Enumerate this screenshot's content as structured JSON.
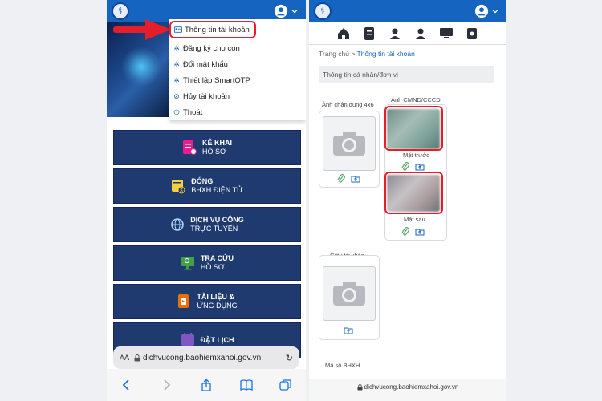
{
  "left": {
    "menu": [
      {
        "label": "Thông tin tài khoản",
        "icon": "id-card-icon"
      },
      {
        "label": "Đăng ký cho con",
        "icon": "gear-icon"
      },
      {
        "label": "Đổi mật khẩu",
        "icon": "gear-icon"
      },
      {
        "label": "Thiết lập SmartOTP",
        "icon": "gear-icon"
      },
      {
        "label": "Hủy tài khoản",
        "icon": "ban-icon"
      },
      {
        "label": "Thoát",
        "icon": "power-icon"
      }
    ],
    "buttons": [
      {
        "title": "KÊ KHAI",
        "sub": "HỒ SƠ",
        "icon": "form-icon",
        "color": "#e91e8c"
      },
      {
        "title": "ĐÓNG",
        "sub": "BHXH ĐIỆN TỬ",
        "icon": "payment-icon",
        "color": "#f4d03f"
      },
      {
        "title": "DỊCH VỤ CÔNG",
        "sub": "TRỰC TUYẾN",
        "icon": "globe-icon",
        "color": "#a9d6f5"
      },
      {
        "title": "TRA CỨU",
        "sub": "HỒ SƠ",
        "icon": "monitor-search-icon",
        "color": "#43a047"
      },
      {
        "title": "TÀI LIỆU &",
        "sub": "ỨNG DỤNG",
        "icon": "document-icon",
        "color": "#ef6c00"
      },
      {
        "title": "ĐẶT LỊCH",
        "sub": "",
        "icon": "calendar-icon",
        "color": "#7e57c2"
      }
    ],
    "urlbar": {
      "aa": "AA",
      "url": "dichvucong.baohiemxahoi.gov.vn"
    }
  },
  "right": {
    "breadcrumb": {
      "home": "Trang chủ",
      "sep": ">",
      "current": "Thông tin tài khoản"
    },
    "section_title": "Thông tin cá nhân/đơn vị",
    "portrait_label": "Ảnh chân dung 4x6",
    "id_label": "Ảnh CMND/CCCD",
    "front_label": "Mặt trước",
    "back_label": "Mặt sau",
    "other_docs_label": "Giấy tờ khác",
    "social_id_label": "Mã số BHXH",
    "bottom_url": "dichvucong.baohiemxahoi.gov.vn"
  },
  "colors": {
    "brand_blue": "#1565c0",
    "highlight_red": "#e41e2b",
    "button_navy": "#1f3a6e"
  }
}
